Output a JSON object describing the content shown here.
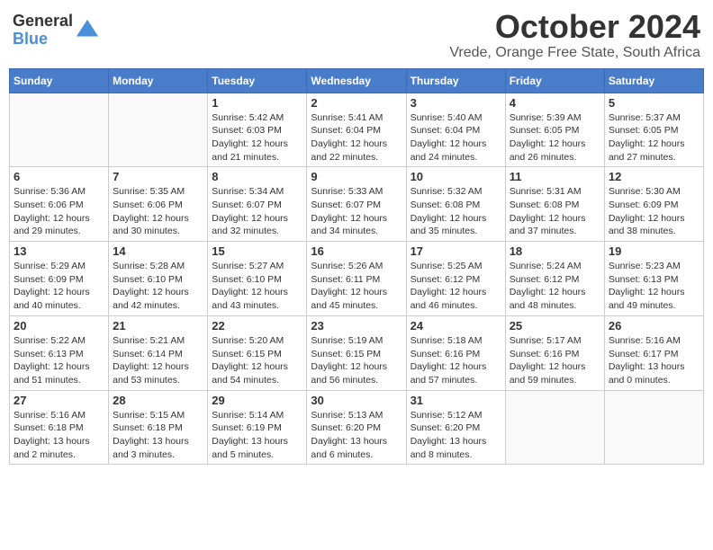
{
  "logo": {
    "general": "General",
    "blue": "Blue"
  },
  "title": {
    "month": "October 2024",
    "location": "Vrede, Orange Free State, South Africa"
  },
  "weekdays": [
    "Sunday",
    "Monday",
    "Tuesday",
    "Wednesday",
    "Thursday",
    "Friday",
    "Saturday"
  ],
  "days": [
    {
      "num": "",
      "info": ""
    },
    {
      "num": "",
      "info": ""
    },
    {
      "num": "1",
      "info": "Sunrise: 5:42 AM\nSunset: 6:03 PM\nDaylight: 12 hours and 21 minutes."
    },
    {
      "num": "2",
      "info": "Sunrise: 5:41 AM\nSunset: 6:04 PM\nDaylight: 12 hours and 22 minutes."
    },
    {
      "num": "3",
      "info": "Sunrise: 5:40 AM\nSunset: 6:04 PM\nDaylight: 12 hours and 24 minutes."
    },
    {
      "num": "4",
      "info": "Sunrise: 5:39 AM\nSunset: 6:05 PM\nDaylight: 12 hours and 26 minutes."
    },
    {
      "num": "5",
      "info": "Sunrise: 5:37 AM\nSunset: 6:05 PM\nDaylight: 12 hours and 27 minutes."
    },
    {
      "num": "6",
      "info": "Sunrise: 5:36 AM\nSunset: 6:06 PM\nDaylight: 12 hours and 29 minutes."
    },
    {
      "num": "7",
      "info": "Sunrise: 5:35 AM\nSunset: 6:06 PM\nDaylight: 12 hours and 30 minutes."
    },
    {
      "num": "8",
      "info": "Sunrise: 5:34 AM\nSunset: 6:07 PM\nDaylight: 12 hours and 32 minutes."
    },
    {
      "num": "9",
      "info": "Sunrise: 5:33 AM\nSunset: 6:07 PM\nDaylight: 12 hours and 34 minutes."
    },
    {
      "num": "10",
      "info": "Sunrise: 5:32 AM\nSunset: 6:08 PM\nDaylight: 12 hours and 35 minutes."
    },
    {
      "num": "11",
      "info": "Sunrise: 5:31 AM\nSunset: 6:08 PM\nDaylight: 12 hours and 37 minutes."
    },
    {
      "num": "12",
      "info": "Sunrise: 5:30 AM\nSunset: 6:09 PM\nDaylight: 12 hours and 38 minutes."
    },
    {
      "num": "13",
      "info": "Sunrise: 5:29 AM\nSunset: 6:09 PM\nDaylight: 12 hours and 40 minutes."
    },
    {
      "num": "14",
      "info": "Sunrise: 5:28 AM\nSunset: 6:10 PM\nDaylight: 12 hours and 42 minutes."
    },
    {
      "num": "15",
      "info": "Sunrise: 5:27 AM\nSunset: 6:10 PM\nDaylight: 12 hours and 43 minutes."
    },
    {
      "num": "16",
      "info": "Sunrise: 5:26 AM\nSunset: 6:11 PM\nDaylight: 12 hours and 45 minutes."
    },
    {
      "num": "17",
      "info": "Sunrise: 5:25 AM\nSunset: 6:12 PM\nDaylight: 12 hours and 46 minutes."
    },
    {
      "num": "18",
      "info": "Sunrise: 5:24 AM\nSunset: 6:12 PM\nDaylight: 12 hours and 48 minutes."
    },
    {
      "num": "19",
      "info": "Sunrise: 5:23 AM\nSunset: 6:13 PM\nDaylight: 12 hours and 49 minutes."
    },
    {
      "num": "20",
      "info": "Sunrise: 5:22 AM\nSunset: 6:13 PM\nDaylight: 12 hours and 51 minutes."
    },
    {
      "num": "21",
      "info": "Sunrise: 5:21 AM\nSunset: 6:14 PM\nDaylight: 12 hours and 53 minutes."
    },
    {
      "num": "22",
      "info": "Sunrise: 5:20 AM\nSunset: 6:15 PM\nDaylight: 12 hours and 54 minutes."
    },
    {
      "num": "23",
      "info": "Sunrise: 5:19 AM\nSunset: 6:15 PM\nDaylight: 12 hours and 56 minutes."
    },
    {
      "num": "24",
      "info": "Sunrise: 5:18 AM\nSunset: 6:16 PM\nDaylight: 12 hours and 57 minutes."
    },
    {
      "num": "25",
      "info": "Sunrise: 5:17 AM\nSunset: 6:16 PM\nDaylight: 12 hours and 59 minutes."
    },
    {
      "num": "26",
      "info": "Sunrise: 5:16 AM\nSunset: 6:17 PM\nDaylight: 13 hours and 0 minutes."
    },
    {
      "num": "27",
      "info": "Sunrise: 5:16 AM\nSunset: 6:18 PM\nDaylight: 13 hours and 2 minutes."
    },
    {
      "num": "28",
      "info": "Sunrise: 5:15 AM\nSunset: 6:18 PM\nDaylight: 13 hours and 3 minutes."
    },
    {
      "num": "29",
      "info": "Sunrise: 5:14 AM\nSunset: 6:19 PM\nDaylight: 13 hours and 5 minutes."
    },
    {
      "num": "30",
      "info": "Sunrise: 5:13 AM\nSunset: 6:20 PM\nDaylight: 13 hours and 6 minutes."
    },
    {
      "num": "31",
      "info": "Sunrise: 5:12 AM\nSunset: 6:20 PM\nDaylight: 13 hours and 8 minutes."
    },
    {
      "num": "",
      "info": ""
    },
    {
      "num": "",
      "info": ""
    }
  ]
}
